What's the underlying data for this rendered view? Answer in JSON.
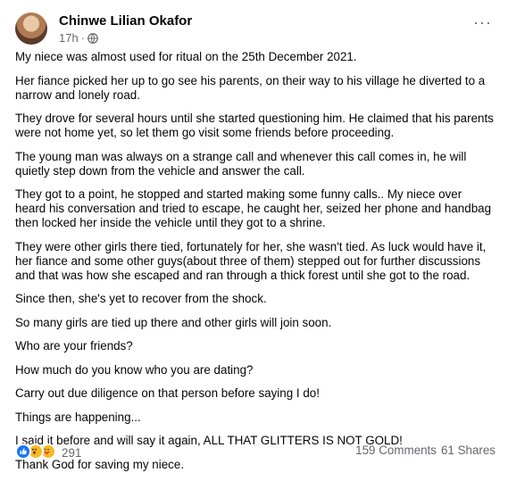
{
  "author": {
    "name": "Chinwe Lilian Okafor",
    "time": "17h",
    "separator": "·"
  },
  "menu": {
    "more_glyph": "···"
  },
  "paragraphs": [
    "My niece was almost used for ritual on the 25th December 2021.",
    "Her fiance picked her up to go see his parents, on their way to his village he diverted to a narrow and lonely road.",
    "They drove for several hours until she started questioning him. He claimed that his parents were not home yet, so let them go visit some friends before proceeding.",
    "The young man was always on a strange call and whenever this call comes in, he will quietly step down from the vehicle and answer the call.",
    "They got to a point, he stopped and started making some funny calls.. My niece over heard his conversation and tried to escape, he caught her, seized her phone and handbag then locked her inside the vehicle until they got to a shrine.",
    "They were other girls there tied, fortunately for her, she wasn't tied. As luck would have it, her fiance and some other guys(about three of them) stepped out for further discussions and that was how she escaped and ran through a thick forest until she got to the road.",
    "Since then, she's yet to recover from the shock.",
    "So many girls are tied up there and other girls will join soon.",
    "Who are your friends?",
    "How much do you know who you are dating?",
    "Carry out due diligence on that person before saying I do!",
    "Things are happening...",
    "I said it before and will say it again, ALL THAT GLITTERS IS NOT GOLD!",
    "Thank God for saving my niece."
  ],
  "engagement": {
    "reactions_count": "291",
    "comments": "159 Comments",
    "shares": "61 Shares",
    "reaction_icons": [
      "like-icon",
      "wow-icon",
      "care-icon"
    ]
  },
  "colors": {
    "secondary_text": "#65676b",
    "like_blue": "#1877f2",
    "emoji_yellow": "#f7b928"
  }
}
